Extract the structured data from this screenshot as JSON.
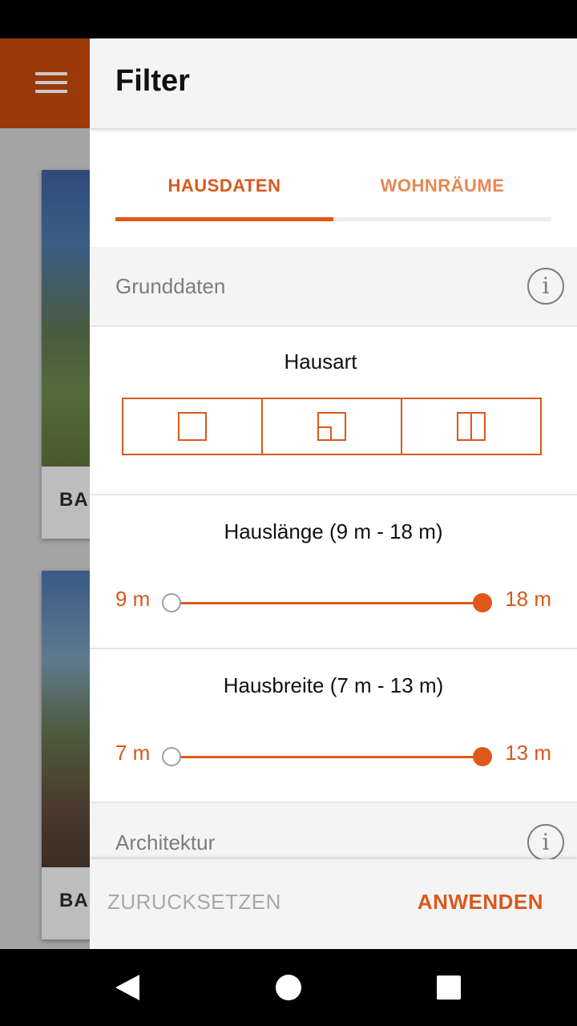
{
  "background": {
    "cards": [
      {
        "caption": "BAU"
      },
      {
        "caption": "BAU"
      }
    ]
  },
  "drawer": {
    "title": "Filter",
    "tabs": [
      {
        "label": "HAUSDATEN",
        "active": true
      },
      {
        "label": "WOHNRÄUME",
        "active": false
      }
    ],
    "sections": [
      {
        "label": "Grunddaten",
        "icon": "info-icon"
      },
      {
        "label": "Architektur",
        "icon": "info-icon"
      }
    ],
    "hausart": {
      "label": "Hausart",
      "options": [
        "single-house-icon",
        "offset-house-icon",
        "double-house-icon"
      ]
    },
    "hauslaenge": {
      "label": "Hauslänge (9 m - 18 m)",
      "min_label": "9 m",
      "max_label": "18 m",
      "min": 9,
      "max": 18,
      "selected_min": 9,
      "selected_max": 18
    },
    "hausbreite": {
      "label": "Hausbreite (7 m - 13 m)",
      "min_label": "7 m",
      "max_label": "13 m",
      "min": 7,
      "max": 13,
      "selected_min": 7,
      "selected_max": 13
    },
    "footer": {
      "reset_label": "ZURUCKSETZEN",
      "apply_label": "ANWENDEN"
    }
  },
  "colors": {
    "accent": "#d9581c",
    "toolbar": "#9a3a08",
    "header_bg": "#f4f4f4",
    "muted_text": "#7d7d7d"
  }
}
